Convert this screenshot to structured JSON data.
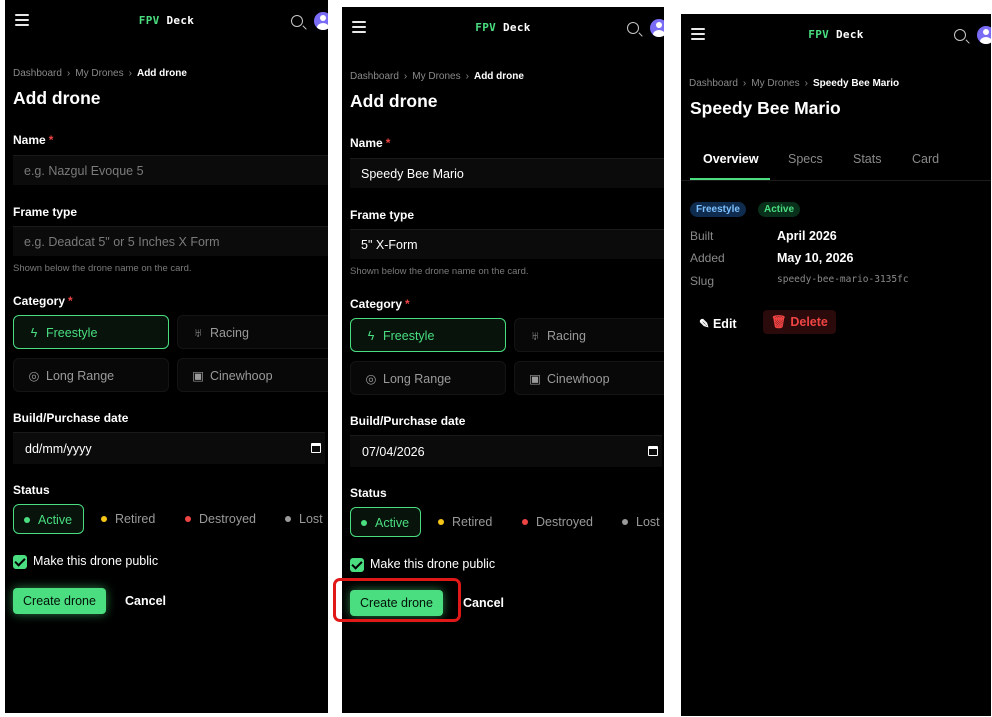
{
  "brand": {
    "fpv": "FPV",
    "deck": "Deck"
  },
  "form": {
    "breadcrumb": [
      "Dashboard",
      "My Drones",
      "Add drone"
    ],
    "title": "Add drone",
    "name_label": "Name",
    "name_placeholder": "e.g. Nazgul Evoque 5",
    "frame_label": "Frame type",
    "frame_placeholder": "e.g. Deadcat 5\" or 5 Inches X Form",
    "frame_help": "Shown below the drone name on the card.",
    "category_label": "Category",
    "categories": [
      "Freestyle",
      "Racing",
      "Long Range",
      "Cinewhoop"
    ],
    "date_label": "Build/Purchase date",
    "date_placeholder": "dd/mm/yyyy",
    "status_label": "Status",
    "statuses": [
      "Active",
      "Retired",
      "Destroyed",
      "Lost"
    ],
    "public_label": "Make this drone public",
    "create_label": "Create drone",
    "cancel_label": "Cancel"
  },
  "filled": {
    "name_value": "Speedy Bee Mario",
    "frame_value": "5\" X-Form",
    "date_value": "07/04/2026"
  },
  "detail": {
    "breadcrumb": [
      "Dashboard",
      "My Drones",
      "Speedy Bee Mario"
    ],
    "title": "Speedy Bee Mario",
    "tabs": [
      "Overview",
      "Specs",
      "Stats",
      "Card"
    ],
    "badges": [
      "Freestyle",
      "Active"
    ],
    "meta": [
      {
        "key": "Built",
        "value": "April 2026"
      },
      {
        "key": "Added",
        "value": "May 10, 2026"
      },
      {
        "key": "Slug",
        "value": "speedy-bee-mario-3135fc"
      }
    ],
    "edit_label": "Edit",
    "delete_label": "Delete"
  },
  "colors": {
    "accent": "#4ade80",
    "danger": "#ef4444",
    "retired": "#f5c518",
    "destroyed": "#ef4444",
    "lost": "#9a9a9a"
  }
}
